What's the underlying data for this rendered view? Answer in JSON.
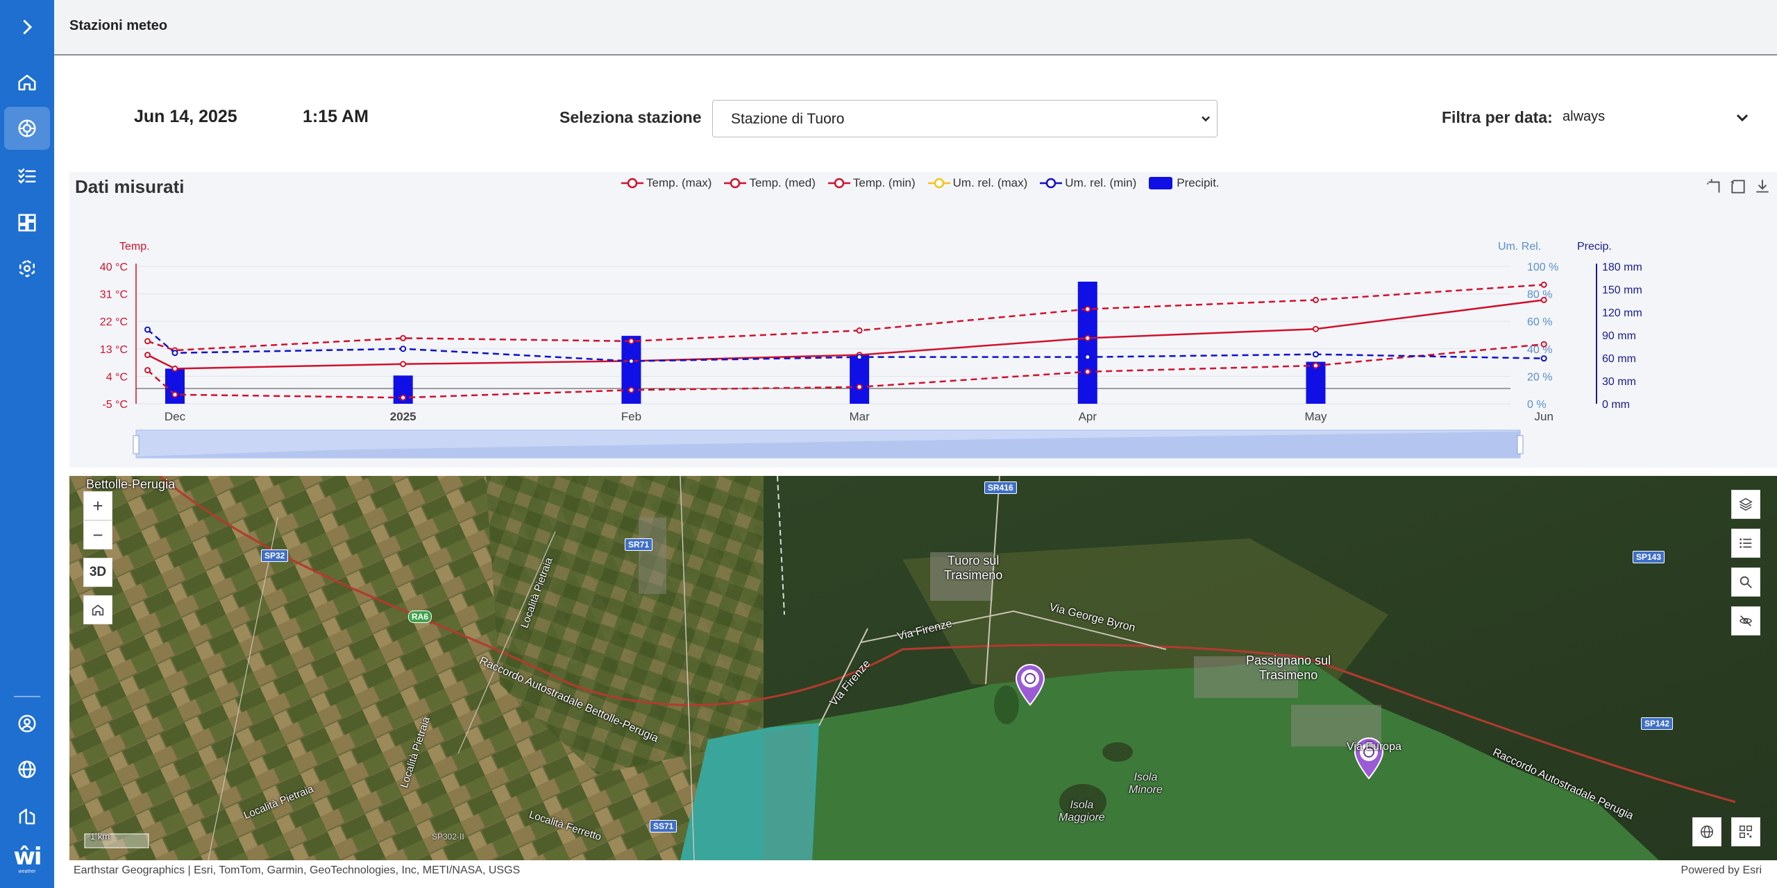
{
  "header": {
    "title": "Stazioni meteo"
  },
  "toolbar": {
    "date": "Jun 14, 2025",
    "time": "1:15 AM",
    "station_label": "Seleziona stazione",
    "station_value": "Stazione di Tuoro",
    "filter_label": "Filtra per data:",
    "filter_value": "always"
  },
  "chart_panel": {
    "title": "Dati misurati",
    "legend": [
      {
        "label": "Temp. (max)",
        "color": "#d0112b",
        "style": "dashed"
      },
      {
        "label": "Temp. (med)",
        "color": "#d0112b",
        "style": "solid"
      },
      {
        "label": "Temp. (min)",
        "color": "#d0112b",
        "style": "dashed"
      },
      {
        "label": "Um. rel. (max)",
        "color": "#f2c418",
        "style": "dashed"
      },
      {
        "label": "Um. rel. (min)",
        "color": "#1010c9",
        "style": "dashed"
      },
      {
        "label": "Precipit.",
        "color": "#1010e6",
        "style": "bar"
      }
    ]
  },
  "chart_data": {
    "type": "line",
    "x_labels": [
      "Dec",
      "2025",
      "Feb",
      "Mar",
      "Apr",
      "May",
      "Jun"
    ],
    "axes": {
      "temp": {
        "label": "Temp.",
        "ticks": [
          "40 °C",
          "31 °C",
          "22 °C",
          "13 °C",
          "4 °C",
          "-5 °C"
        ],
        "range": [
          -5,
          40
        ],
        "color": "#d0112b"
      },
      "humidity": {
        "label": "Um. Rel.",
        "ticks": [
          "100 %",
          "80 %",
          "60 %",
          "40 %",
          "20 %",
          "0 %"
        ],
        "range": [
          0,
          100
        ],
        "color": "#5a8fc9"
      },
      "precip": {
        "label": "Precip.",
        "ticks": [
          "180 mm",
          "150 mm",
          "120 mm",
          "90 mm",
          "60 mm",
          "30 mm",
          "0 mm"
        ],
        "range": [
          0,
          180
        ],
        "color": "#1a1a8c"
      }
    },
    "series": [
      {
        "name": "Temp. (max)",
        "axis": "temp",
        "style": "dashed",
        "color": "#d0112b",
        "x": [
          -0.12,
          0,
          1,
          2,
          3,
          4,
          5,
          6
        ],
        "values": [
          15.5,
          12.5,
          16.5,
          15.5,
          19,
          26,
          29,
          34
        ]
      },
      {
        "name": "Temp. (med)",
        "axis": "temp",
        "style": "solid",
        "color": "#d0112b",
        "x": [
          -0.12,
          0,
          1,
          2,
          3,
          4,
          5,
          6
        ],
        "values": [
          11,
          6.5,
          8,
          9,
          11,
          16.5,
          19.5,
          29
        ]
      },
      {
        "name": "Temp. (min)",
        "axis": "temp",
        "style": "dashed",
        "color": "#d0112b",
        "x": [
          -0.12,
          0,
          1,
          2,
          3,
          4,
          5,
          6
        ],
        "values": [
          6,
          -2,
          -3,
          -0.5,
          0.5,
          5.5,
          7.5,
          14.5
        ]
      },
      {
        "name": "Um. rel. (min)",
        "axis": "humidity",
        "style": "dashed",
        "color": "#1010c9",
        "x": [
          -0.12,
          0,
          1,
          2,
          3,
          4,
          5,
          6
        ],
        "values": [
          54,
          37,
          40,
          31,
          34,
          34,
          36,
          33
        ]
      }
    ],
    "bars": {
      "name": "Precipit.",
      "axis": "precip",
      "color": "#1010e6",
      "x": [
        0,
        1,
        2,
        3,
        4,
        5
      ],
      "values": [
        46,
        37,
        89,
        64,
        160,
        55
      ]
    }
  },
  "map": {
    "places": [
      {
        "name": "Tuoro sul",
        "line2": "Trasimeno"
      },
      {
        "name": "Passignano sul",
        "line2": "Trasimeno"
      }
    ],
    "roads": [
      "Raccordo Autostradale Bettolle-Perugia",
      "Raccordo Autostradale Perugia",
      "Bettolle-Perugia",
      "Via Firenze",
      "Via George Byron",
      "Via Firenze",
      "Via Europa",
      "Località Pietraia",
      "Località Pietraia",
      "Località Pietraia",
      "Località Ferretto"
    ],
    "islands": [
      {
        "name": "Isola",
        "line2": "Minore"
      },
      {
        "name": "Isola",
        "line2": "Maggiore"
      }
    ],
    "shields": [
      "SR416",
      "SP32",
      "SR71",
      "RA6",
      "SP143",
      "SP142",
      "SS71",
      "SP302-II"
    ],
    "scale": "1 km",
    "controls": {
      "zoom_in": "+",
      "zoom_out": "−",
      "three_d": "3D"
    }
  },
  "attribution": {
    "left": "Earthstar Geographics | Esri, TomTom, Garmin, GeoTechnologies, Inc, METI/NASA, USGS",
    "right": "Powered by Esri"
  }
}
